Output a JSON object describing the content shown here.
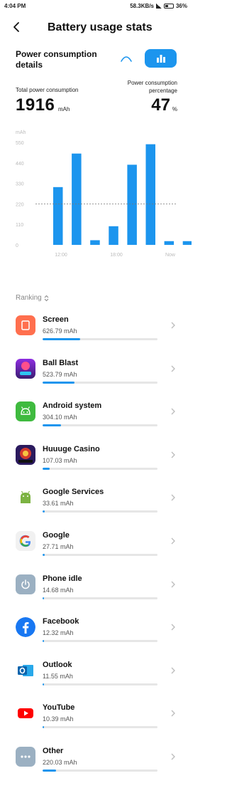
{
  "status_bar": {
    "time": "4:04 PM",
    "network": "58.3KB/s",
    "battery": "36%"
  },
  "header": {
    "title": "Battery usage stats"
  },
  "power": {
    "title": "Power consumption details",
    "total_label": "Total power consumption",
    "total_value": "1916",
    "total_unit": "mAh",
    "pct_label": "Power consumption percentage",
    "pct_value": "47",
    "pct_unit": "%"
  },
  "chart_data": {
    "type": "bar",
    "y_unit": "mAh",
    "y_ticks": [
      "550",
      "440",
      "330",
      "220",
      "110",
      "0"
    ],
    "x_ticks": [
      "12:00",
      "18:00",
      "Now"
    ],
    "categories": [
      "",
      "",
      "",
      "",
      "",
      "",
      "",
      ""
    ],
    "values": [
      310,
      490,
      25,
      100,
      430,
      540,
      20,
      20
    ],
    "average": 220,
    "ylim": [
      0,
      550
    ]
  },
  "ranking": {
    "label": "Ranking"
  },
  "apps": [
    {
      "name": "Screen",
      "usage": "626.79 mAh",
      "fraction": 0.33,
      "icon": "screen-icon"
    },
    {
      "name": "Ball Blast",
      "usage": "523.79 mAh",
      "fraction": 0.28,
      "icon": "ball-blast-icon"
    },
    {
      "name": "Android system",
      "usage": "304.10 mAh",
      "fraction": 0.16,
      "icon": "android-system-icon"
    },
    {
      "name": "Huuuge Casino",
      "usage": "107.03 mAh",
      "fraction": 0.06,
      "icon": "huuuge-casino-icon"
    },
    {
      "name": "Google Services",
      "usage": "33.61 mAh",
      "fraction": 0.02,
      "icon": "google-services-icon"
    },
    {
      "name": "Google",
      "usage": "27.71 mAh",
      "fraction": 0.02,
      "icon": "google-icon"
    },
    {
      "name": "Phone idle",
      "usage": "14.68 mAh",
      "fraction": 0.01,
      "icon": "power-icon"
    },
    {
      "name": "Facebook",
      "usage": "12.32 mAh",
      "fraction": 0.01,
      "icon": "facebook-icon"
    },
    {
      "name": "Outlook",
      "usage": "11.55 mAh",
      "fraction": 0.01,
      "icon": "outlook-icon"
    },
    {
      "name": "YouTube",
      "usage": "10.39 mAh",
      "fraction": 0.01,
      "icon": "youtube-icon"
    },
    {
      "name": "Other",
      "usage": "220.03 mAh",
      "fraction": 0.12,
      "icon": "other-icon"
    }
  ],
  "colors": {
    "accent": "#1c95ee"
  }
}
